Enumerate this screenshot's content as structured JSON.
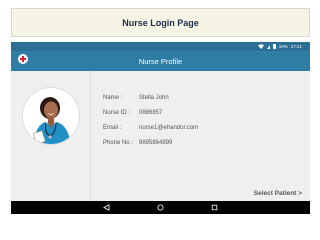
{
  "slide_title": "Nurse Login Page",
  "status_bar": {
    "battery_percent": "10%",
    "time": "17:41"
  },
  "app_bar": {
    "title": "Nurse Profile",
    "logo_icon": "medical-cross-icon"
  },
  "profile": {
    "avatar_icon": "nurse-photo",
    "fields": [
      {
        "label": "Name :",
        "value": "Stella John"
      },
      {
        "label": "Nurse ID :",
        "value": "0886857"
      },
      {
        "label": "Email :",
        "value": "nurse1@ehandor.com"
      },
      {
        "label": "Phone No :",
        "value": "9895864899"
      }
    ]
  },
  "actions": {
    "select_patient": "Select Patient >"
  },
  "nav_bar": {
    "icons": [
      "back-icon",
      "home-icon",
      "recents-icon"
    ]
  },
  "colors": {
    "app_bar": "#2f7ca4",
    "status_bar": "#2b6f95",
    "slide_title_bg": "#f5f3e4",
    "content_bg": "#efefef"
  }
}
